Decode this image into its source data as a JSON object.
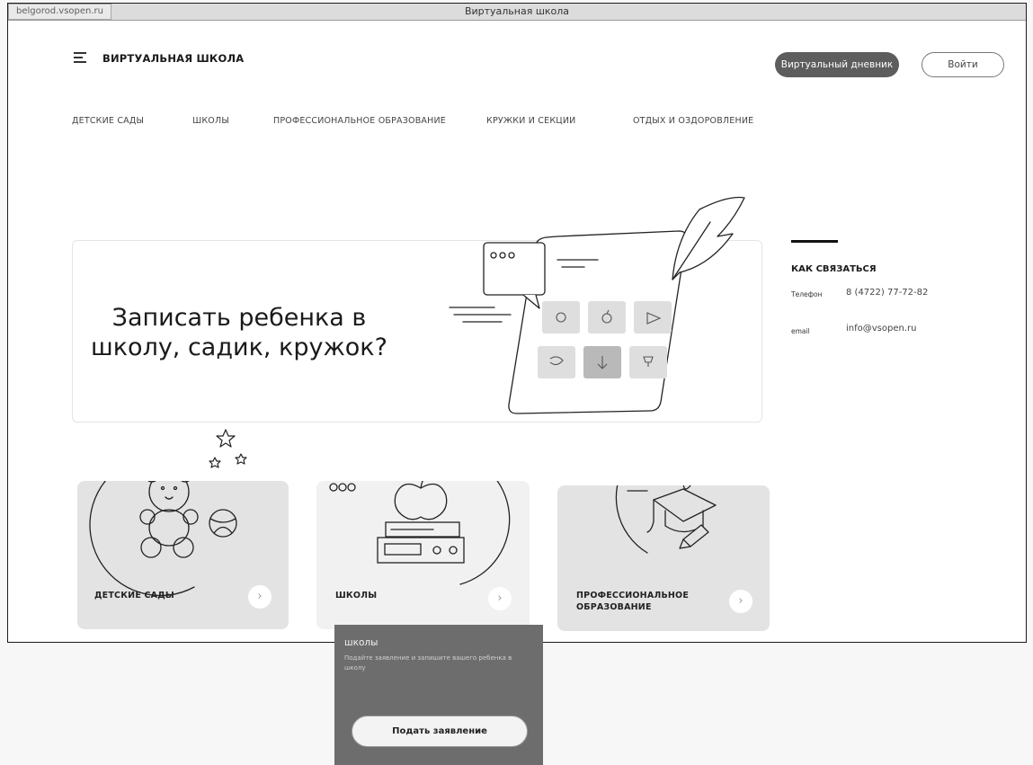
{
  "browser": {
    "url": "belgorod.vsopen.ru",
    "title": "Виртуальная школа"
  },
  "header": {
    "brand": "ВИРТУАЛЬНАЯ ШКОЛА",
    "diary_button": "Виртуальный дневник",
    "login_button": "Войти"
  },
  "nav": [
    {
      "label": "ДЕТСКИЕ САДЫ"
    },
    {
      "label": "ШКОЛЫ"
    },
    {
      "label": "ПРОФЕССИОНАЛЬНОЕ ОБРАЗОВАНИЕ"
    },
    {
      "label": "КРУЖКИ И СЕКЦИИ"
    },
    {
      "label": "ОТДЫХ И ОЗДОРОВЛЕНИЕ"
    }
  ],
  "hero": {
    "title_line1": "Записать ребенка в",
    "title_line2": "школу, садик, кружок?"
  },
  "contact": {
    "title": "КАК СВЯЗАТЬСЯ",
    "phone_label": "Телефон",
    "phone": "8 (4722) 77-72-82",
    "email_label": "email",
    "email": "info@vsopen.ru"
  },
  "cards": [
    {
      "label": "ДЕТСКИЕ САДЫ",
      "icon": "teddy-bear-icon"
    },
    {
      "label": "ШКОЛЫ",
      "icon": "apple-books-icon"
    },
    {
      "label_line1": "ПРОФЕССИОНАЛЬНОЕ",
      "label_line2": "ОБРАЗОВАНИЕ",
      "icon": "graduation-cap-icon"
    }
  ],
  "popup": {
    "title": "школы",
    "description": "Подайте заявление и запишите вашего ребенка в школу",
    "button": "Подать заявление"
  }
}
